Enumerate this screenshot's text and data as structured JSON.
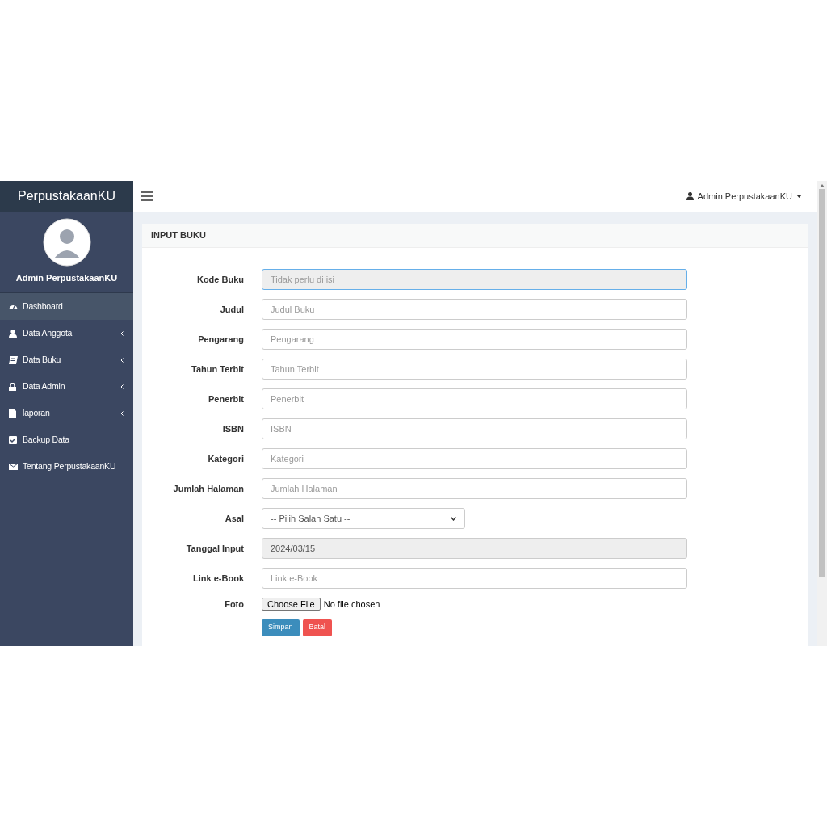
{
  "sidebar": {
    "brand": "PerpustakaanKU",
    "user_name": "Admin PerpustakaanKU",
    "items": [
      {
        "label": "Dashboard",
        "selected": true,
        "expandable": false
      },
      {
        "label": "Data Anggota",
        "selected": false,
        "expandable": true
      },
      {
        "label": "Data Buku",
        "selected": false,
        "expandable": true
      },
      {
        "label": "Data Admin",
        "selected": false,
        "expandable": true
      },
      {
        "label": "laporan",
        "selected": false,
        "expandable": true
      },
      {
        "label": "Backup Data",
        "selected": false,
        "expandable": false
      },
      {
        "label": "Tentang PerpustakaanKU",
        "selected": false,
        "expandable": false
      }
    ]
  },
  "navbar": {
    "user": "Admin PerpustakaanKU"
  },
  "form": {
    "title": "INPUT BUKU",
    "fields": [
      {
        "kind": "text",
        "label": "Kode Buku",
        "placeholder": "Tidak perlu di isi",
        "readonly": true,
        "focused": true
      },
      {
        "kind": "text",
        "label": "Judul",
        "placeholder": "Judul Buku",
        "readonly": false,
        "focused": false
      },
      {
        "kind": "text",
        "label": "Pengarang",
        "placeholder": "Pengarang",
        "readonly": false,
        "focused": false
      },
      {
        "kind": "text",
        "label": "Tahun Terbit",
        "placeholder": "Tahun Terbit",
        "readonly": false,
        "focused": false
      },
      {
        "kind": "text",
        "label": "Penerbit",
        "placeholder": "Penerbit",
        "readonly": false,
        "focused": false
      },
      {
        "kind": "text",
        "label": "ISBN",
        "placeholder": "ISBN",
        "readonly": false,
        "focused": false
      },
      {
        "kind": "text",
        "label": "Kategori",
        "placeholder": "Kategori",
        "readonly": false,
        "focused": false
      },
      {
        "kind": "text",
        "label": "Jumlah Halaman",
        "placeholder": "Jumlah Halaman",
        "readonly": false,
        "focused": false
      },
      {
        "kind": "select",
        "label": "Asal",
        "value": "-- Pilih Salah Satu --"
      },
      {
        "kind": "text",
        "label": "Tanggal Input",
        "value": "2024/03/15",
        "readonly": true,
        "focused": false
      },
      {
        "kind": "text",
        "label": "Link e-Book",
        "placeholder": "Link e-Book",
        "readonly": false,
        "focused": false
      },
      {
        "kind": "file",
        "label": "Foto",
        "button": "Choose File",
        "status": "No file chosen"
      }
    ],
    "buttons": [
      {
        "label": "Simpan",
        "kind": "primary"
      },
      {
        "label": "Batal",
        "kind": "danger"
      }
    ]
  }
}
